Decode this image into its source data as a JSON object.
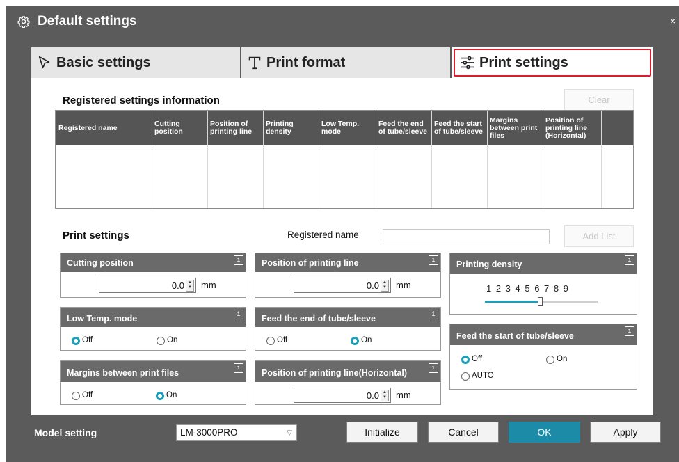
{
  "window": {
    "title": "Default settings",
    "close_icon": "×"
  },
  "tabs": [
    {
      "label": "Basic settings",
      "icon": "cursor-arrow-icon"
    },
    {
      "label": "Print format",
      "icon": "text-t-icon"
    },
    {
      "label": "Print settings",
      "icon": "sliders-icon",
      "active": true
    }
  ],
  "registered": {
    "title": "Registered settings information",
    "clear_label": "Clear",
    "columns": [
      "Registered name",
      "Cutting position",
      "Position of printing line",
      "Printing density",
      "Low Temp. mode",
      "Feed the end of tube/sleeve",
      "Feed the start of tube/sleeve",
      "Margins between print files",
      "Position of printing line (Horizontal)"
    ]
  },
  "print_settings": {
    "title": "Print settings",
    "registered_name_label": "Registered name",
    "registered_name_value": "",
    "add_list_label": "Add List",
    "info_icon_glyph": "i",
    "cutting_position": {
      "label": "Cutting position",
      "value": "0.0",
      "unit": "mm"
    },
    "position_printing_line": {
      "label": "Position of printing line",
      "value": "0.0",
      "unit": "mm"
    },
    "printing_density": {
      "label": "Printing density",
      "scale": "1 2 3 4 5 6 7 8 9",
      "value": 5
    },
    "low_temp_mode": {
      "label": "Low Temp. mode",
      "options": [
        "Off",
        "On"
      ],
      "selected": "Off"
    },
    "feed_end": {
      "label": "Feed the end of tube/sleeve",
      "options": [
        "Off",
        "On"
      ],
      "selected": "On"
    },
    "feed_start": {
      "label": "Feed the start of tube/sleeve",
      "options": [
        "Off",
        "On",
        "AUTO"
      ],
      "selected": "Off"
    },
    "margins": {
      "label": "Margins between print files",
      "options": [
        "Off",
        "On"
      ],
      "selected": "On"
    },
    "position_horizontal": {
      "label": "Position of printing line(Horizontal)",
      "value": "0.0",
      "unit": "mm"
    }
  },
  "footer": {
    "model_label": "Model setting",
    "model_value": "LM-3000PRO",
    "initialize_label": "Initialize",
    "cancel_label": "Cancel",
    "ok_label": "OK",
    "apply_label": "Apply"
  },
  "colors": {
    "accent": "#1aa0b9",
    "ok_button": "#1b8ba7",
    "highlight_border": "#d81e2c",
    "chrome": "#5b5b5b"
  }
}
